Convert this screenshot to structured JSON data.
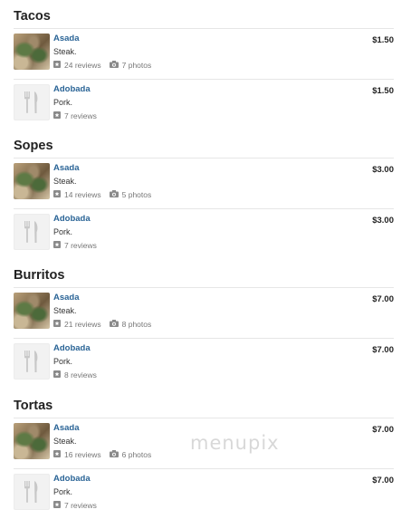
{
  "sections": [
    {
      "title": "Tacos",
      "items": [
        {
          "name": "Asada",
          "description": "Steak.",
          "reviews": "24 reviews",
          "photos": "7 photos",
          "price": "$1.50",
          "image": "photo"
        },
        {
          "name": "Adobada",
          "description": "Pork.",
          "reviews": "7 reviews",
          "photos": "",
          "price": "$1.50",
          "image": "placeholder"
        }
      ]
    },
    {
      "title": "Sopes",
      "items": [
        {
          "name": "Asada",
          "description": "Steak.",
          "reviews": "14 reviews",
          "photos": "5 photos",
          "price": "$3.00",
          "image": "photo"
        },
        {
          "name": "Adobada",
          "description": "Pork.",
          "reviews": "7 reviews",
          "photos": "",
          "price": "$3.00",
          "image": "placeholder"
        }
      ]
    },
    {
      "title": "Burritos",
      "items": [
        {
          "name": "Asada",
          "description": "Steak.",
          "reviews": "21 reviews",
          "photos": "8 photos",
          "price": "$7.00",
          "image": "photo"
        },
        {
          "name": "Adobada",
          "description": "Pork.",
          "reviews": "8 reviews",
          "photos": "",
          "price": "$7.00",
          "image": "placeholder"
        }
      ]
    },
    {
      "title": "Tortas",
      "items": [
        {
          "name": "Asada",
          "description": "Steak.",
          "reviews": "16 reviews",
          "photos": "6 photos",
          "price": "$7.00",
          "image": "photo"
        },
        {
          "name": "Adobada",
          "description": "Pork.",
          "reviews": "7 reviews",
          "photos": "",
          "price": "$7.00",
          "image": "placeholder"
        }
      ]
    }
  ],
  "watermark": "menupix",
  "icons": {
    "review": "review-icon",
    "photo": "camera-icon",
    "placeholder": "fork-knife-icon"
  },
  "colors": {
    "item_name": "#2a6496",
    "divider": "#e6e6e6"
  }
}
